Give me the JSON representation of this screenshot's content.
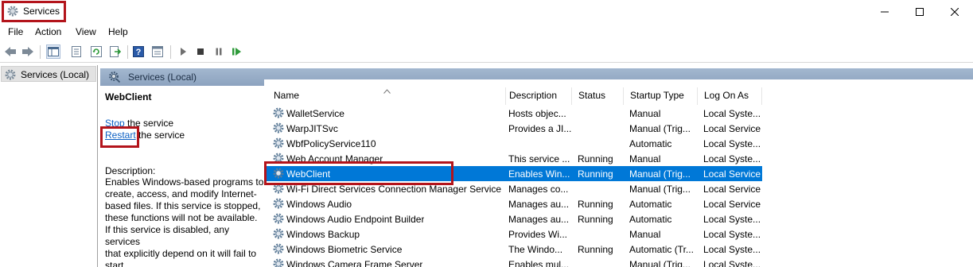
{
  "window": {
    "title": "Services"
  },
  "menu": [
    "File",
    "Action",
    "View",
    "Help"
  ],
  "tree": {
    "label": "Services (Local)"
  },
  "header": {
    "label": "Services (Local)"
  },
  "detail": {
    "service_name": "WebClient",
    "stop_link": "Stop",
    "stop_rest": " the service",
    "restart_link": "Restart",
    "restart_rest": " the service",
    "description_label": "Description:",
    "description": "Enables Windows-based programs to\ncreate, access, and modify Internet-\nbased files. If this service is stopped,\nthese functions will not be available.\nIf this service is disabled, any services\nthat explicitly depend on it will fail to\nstart."
  },
  "columns": {
    "name": "Name",
    "description": "Description",
    "status": "Status",
    "startup": "Startup Type",
    "logon": "Log On As"
  },
  "rows": [
    {
      "name": "WalletService",
      "description": "Hosts objec...",
      "status": "",
      "startup": "Manual",
      "logon": "Local Syste..."
    },
    {
      "name": "WarpJITSvc",
      "description": "Provides a JI...",
      "status": "",
      "startup": "Manual (Trig...",
      "logon": "Local Service"
    },
    {
      "name": "WbfPolicyService110",
      "description": "",
      "status": "",
      "startup": "Automatic",
      "logon": "Local Syste..."
    },
    {
      "name": "Web Account Manager",
      "description": "This service ...",
      "status": "Running",
      "startup": "Manual",
      "logon": "Local Syste..."
    },
    {
      "name": "WebClient",
      "description": "Enables Win...",
      "status": "Running",
      "startup": "Manual (Trig...",
      "logon": "Local Service"
    },
    {
      "name": "Wi-Fi Direct Services Connection Manager Service",
      "description": "Manages co...",
      "status": "",
      "startup": "Manual (Trig...",
      "logon": "Local Service"
    },
    {
      "name": "Windows Audio",
      "description": "Manages au...",
      "status": "Running",
      "startup": "Automatic",
      "logon": "Local Service"
    },
    {
      "name": "Windows Audio Endpoint Builder",
      "description": "Manages au...",
      "status": "Running",
      "startup": "Automatic",
      "logon": "Local Syste..."
    },
    {
      "name": "Windows Backup",
      "description": "Provides Wi...",
      "status": "",
      "startup": "Manual",
      "logon": "Local Syste..."
    },
    {
      "name": "Windows Biometric Service",
      "description": "The Windo...",
      "status": "Running",
      "startup": "Automatic (Tr...",
      "logon": "Local Syste..."
    },
    {
      "name": "Windows Camera Frame Server",
      "description": "Enables mul...",
      "status": "",
      "startup": "Manual (Trig...",
      "logon": "Local Syste..."
    }
  ],
  "selected_row": "WebClient",
  "colors": {
    "selection": "#0078d7",
    "highlight_box": "#b3141b",
    "link": "#0b5fc4",
    "header_band": "#98adc8"
  },
  "toolbar_icons": [
    "back-icon",
    "forward-icon",
    "console-tree-icon",
    "properties-icon",
    "refresh-icon",
    "export-list-icon",
    "help-icon",
    "view-icon",
    "start-icon",
    "stop-icon",
    "pause-icon",
    "restart-icon"
  ]
}
